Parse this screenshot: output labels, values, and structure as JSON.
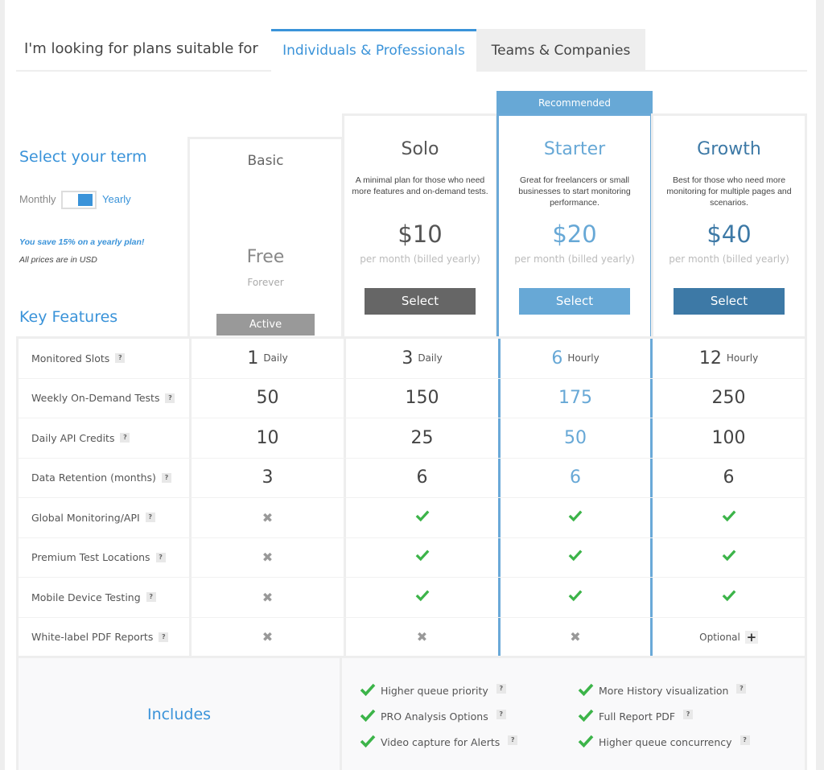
{
  "tabs": {
    "prompt": "I'm looking for plans suitable for",
    "items": [
      {
        "label": "Individuals & Professionals",
        "active": true
      },
      {
        "label": "Teams & Companies",
        "active": false
      }
    ]
  },
  "term": {
    "title": "Select your term",
    "monthly_label": "Monthly",
    "yearly_label": "Yearly",
    "selected": "Yearly",
    "save_note": "You save 15% on a yearly plan!",
    "currency_note": "All prices are in USD"
  },
  "key_features_title": "Key Features",
  "recommended_badge": "Recommended",
  "colors": {
    "accent": "#3a93d9",
    "solo": "#555555",
    "starter": "#67a8d6",
    "growth": "#3d79a6",
    "basic_button": "#999999",
    "solo_button": "#666666",
    "check": "#3cb449",
    "cross": "#999999"
  },
  "plans": [
    {
      "name": "Basic",
      "description": "",
      "price": "Free",
      "period": "Forever",
      "button": "Active"
    },
    {
      "name": "Solo",
      "description": "A minimal plan for those who need more features and on-demand tests.",
      "price": "$10",
      "period": "per month (billed yearly)",
      "button": "Select"
    },
    {
      "name": "Starter",
      "description": "Great for freelancers or small businesses to start monitoring performance.",
      "price": "$20",
      "period": "per month (billed yearly)",
      "button": "Select"
    },
    {
      "name": "Growth",
      "description": "Best for those who need more monitoring for multiple pages and scenarios.",
      "price": "$40",
      "period": "per month (billed yearly)",
      "button": "Select"
    }
  ],
  "help_glyph": "?",
  "features": [
    {
      "label": "Monitored Slots",
      "values": [
        {
          "main": "1",
          "sub": "Daily"
        },
        {
          "main": "3",
          "sub": "Daily"
        },
        {
          "main": "6",
          "sub": "Hourly"
        },
        {
          "main": "12",
          "sub": "Hourly"
        }
      ]
    },
    {
      "label": "Weekly On-Demand Tests",
      "values": [
        {
          "main": "50"
        },
        {
          "main": "150"
        },
        {
          "main": "175"
        },
        {
          "main": "250"
        }
      ]
    },
    {
      "label": "Daily API Credits",
      "values": [
        {
          "main": "10"
        },
        {
          "main": "25"
        },
        {
          "main": "50"
        },
        {
          "main": "100"
        }
      ]
    },
    {
      "label": "Data Retention (months)",
      "values": [
        {
          "main": "3"
        },
        {
          "main": "6"
        },
        {
          "main": "6"
        },
        {
          "main": "6"
        }
      ]
    },
    {
      "label": "Global Monitoring/API",
      "values": [
        {
          "icon": "cross"
        },
        {
          "icon": "check"
        },
        {
          "icon": "check"
        },
        {
          "icon": "check"
        }
      ]
    },
    {
      "label": "Premium Test Locations",
      "values": [
        {
          "icon": "cross"
        },
        {
          "icon": "check"
        },
        {
          "icon": "check"
        },
        {
          "icon": "check"
        }
      ]
    },
    {
      "label": "Mobile Device Testing",
      "values": [
        {
          "icon": "cross"
        },
        {
          "icon": "check"
        },
        {
          "icon": "check"
        },
        {
          "icon": "check"
        }
      ]
    },
    {
      "label": "White-label PDF Reports",
      "values": [
        {
          "icon": "cross"
        },
        {
          "icon": "cross"
        },
        {
          "icon": "cross"
        },
        {
          "optional": "Optional"
        }
      ]
    }
  ],
  "includes": {
    "title": "Includes",
    "items": [
      "Higher queue priority",
      "PRO Analysis Options",
      "Video capture for Alerts",
      "More History visualization",
      "Full Report PDF",
      "Higher queue concurrency"
    ]
  }
}
